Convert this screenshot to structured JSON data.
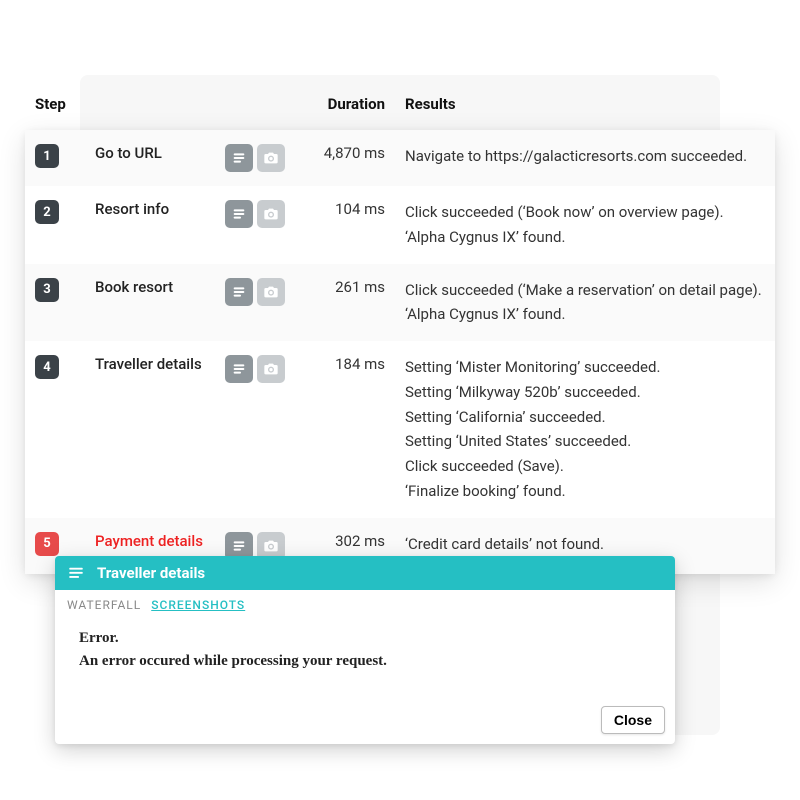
{
  "headers": {
    "step": "Step",
    "duration": "Duration",
    "results": "Results"
  },
  "steps": [
    {
      "num": "1",
      "name": "Go to URL",
      "duration": "4,870 ms",
      "results": [
        "Navigate to https://galacticresorts.com succeeded."
      ],
      "error": false
    },
    {
      "num": "2",
      "name": "Resort info",
      "duration": "104 ms",
      "results": [
        "Click succeeded (‘Book now’ on overview page).",
        "‘Alpha Cygnus IX’ found."
      ],
      "error": false
    },
    {
      "num": "3",
      "name": "Book resort",
      "duration": "261 ms",
      "results": [
        "Click succeeded (‘Make a reservation’ on detail page).",
        "‘Alpha Cygnus IX’ found."
      ],
      "error": false
    },
    {
      "num": "4",
      "name": "Traveller details",
      "duration": "184 ms",
      "results": [
        "Setting ‘Mister Monitoring’ succeeded.",
        "Setting ‘Milkyway 520b’ succeeded.",
        "Setting ‘California’ succeeded.",
        "Setting ‘United States’ succeeded.",
        "Click succeeded (Save).",
        "‘Finalize booking’ found."
      ],
      "error": false
    },
    {
      "num": "5",
      "name": "Payment details",
      "duration": "302 ms",
      "results": [
        "‘Credit card details’ not found."
      ],
      "error": true
    }
  ],
  "panel": {
    "title": "Traveller details",
    "tab_waterfall": "WATERFALL",
    "tab_screenshots": "SCREENSHOTS",
    "error_title": "Error.",
    "error_message": "An error occured while processing your request.",
    "close": "Close"
  }
}
